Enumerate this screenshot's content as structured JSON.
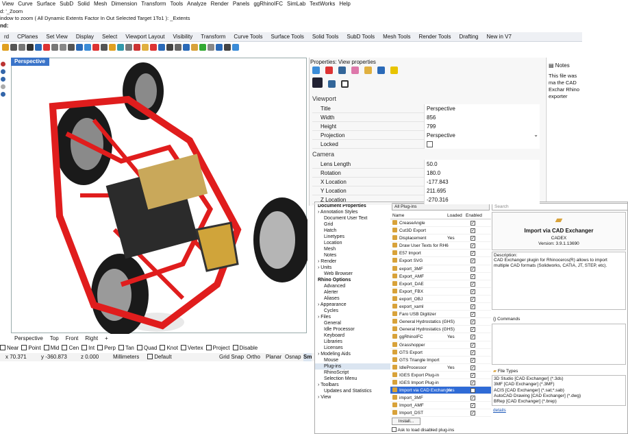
{
  "menubar": [
    "View",
    "Curve",
    "Surface",
    "SubD",
    "Solid",
    "Mesh",
    "Dimension",
    "Transform",
    "Tools",
    "Analyze",
    "Render",
    "Panels",
    "ggRhinoIFC",
    "SimLab",
    "TextWorks",
    "Help"
  ],
  "cmd": {
    "line1": "d: '_Zoom",
    "line2": "indow to zoom ( All  Dynamic  Extents  Factor  In  Out  Selected  Target  1To1 ): _Extents",
    "prompt": "nd:"
  },
  "tabs": [
    "rd",
    "CPlanes",
    "Set View",
    "Display",
    "Select",
    "Viewport Layout",
    "Visibility",
    "Transform",
    "Curve Tools",
    "Surface Tools",
    "Solid Tools",
    "SubD Tools",
    "Mesh Tools",
    "Render Tools",
    "Drafting",
    "New in V7"
  ],
  "viewport": {
    "title": "Perspective"
  },
  "vptabs": [
    "Perspective",
    "Top",
    "Front",
    "Right",
    "+"
  ],
  "osnap": [
    "Near",
    "Point",
    "Mid",
    "Cen",
    "Int",
    "Perp",
    "Tan",
    "Quad",
    "Knot",
    "Vertex",
    "Project",
    "Disable"
  ],
  "status": {
    "x": "x 70.371",
    "y": "y -360.873",
    "z": "z 0.000",
    "units": "Millimeters",
    "layer": "Default",
    "grid": "Grid Snap",
    "ortho": "Ortho",
    "planar": "Planar",
    "osnap": "Osnap",
    "sm": "Sm"
  },
  "props": {
    "title": "Properties: View properties",
    "sec1": "Viewport",
    "sec2": "Camera",
    "rows1": [
      {
        "k": "Title",
        "v": "Perspective"
      },
      {
        "k": "Width",
        "v": "856"
      },
      {
        "k": "Height",
        "v": "799"
      },
      {
        "k": "Projection",
        "v": "Perspective"
      },
      {
        "k": "Locked",
        "v": ""
      }
    ],
    "rows2": [
      {
        "k": "Lens Length",
        "v": "50.0"
      },
      {
        "k": "Rotation",
        "v": "180.0"
      },
      {
        "k": "X Location",
        "v": "-177.843"
      },
      {
        "k": "Y Location",
        "v": "211.695"
      },
      {
        "k": "Z Location",
        "v": "-270.316"
      }
    ]
  },
  "notes": {
    "title": "Notes",
    "text": "This file was ma the CAD Exchar Rhino exporter"
  },
  "tree": [
    {
      "t": "Document Properties",
      "b": true
    },
    {
      "t": "Annotation Styles",
      "c": true
    },
    {
      "t": "Document User Text"
    },
    {
      "t": "Grid"
    },
    {
      "t": "Hatch"
    },
    {
      "t": "Linetypes"
    },
    {
      "t": "Location"
    },
    {
      "t": "Mesh"
    },
    {
      "t": "Notes"
    },
    {
      "t": "Render",
      "c": true
    },
    {
      "t": "Units",
      "c": true
    },
    {
      "t": "Web Browser"
    },
    {
      "t": "Rhino Options",
      "b": true
    },
    {
      "t": "Advanced"
    },
    {
      "t": "Alerter"
    },
    {
      "t": "Aliases"
    },
    {
      "t": "Appearance",
      "c": true
    },
    {
      "t": "Cycles"
    },
    {
      "t": "Files",
      "c": true
    },
    {
      "t": "General"
    },
    {
      "t": "Idle Processor"
    },
    {
      "t": "Keyboard"
    },
    {
      "t": "Libraries"
    },
    {
      "t": "Licenses"
    },
    {
      "t": "Modeling Aids",
      "c": true
    },
    {
      "t": "Mouse"
    },
    {
      "t": "Plug-ins",
      "s": true
    },
    {
      "t": "RhinoScript"
    },
    {
      "t": "Selection Menu"
    },
    {
      "t": "Toolbars",
      "c": true
    },
    {
      "t": "Updates and Statistics"
    },
    {
      "t": "View",
      "c": true
    }
  ],
  "plugins": {
    "filter": "All Plug-ins",
    "search": "Search",
    "cols": [
      "Name",
      "Loaded",
      "Enabled"
    ],
    "items": [
      {
        "n": "CreaseAngle",
        "l": ""
      },
      {
        "n": "Cut3D Export",
        "l": ""
      },
      {
        "n": "Displacement",
        "l": "Yes"
      },
      {
        "n": "Draw User Texts for RH6",
        "l": ""
      },
      {
        "n": "E57 Import",
        "l": ""
      },
      {
        "n": "Export SVG",
        "l": ""
      },
      {
        "n": "export_3MF",
        "l": ""
      },
      {
        "n": "Export_AMF",
        "l": ""
      },
      {
        "n": "Export_DAE",
        "l": ""
      },
      {
        "n": "Export_FBX",
        "l": ""
      },
      {
        "n": "export_OBJ",
        "l": ""
      },
      {
        "n": "export_xaml",
        "l": ""
      },
      {
        "n": "Faro USB Digitizer",
        "l": ""
      },
      {
        "n": "General Hydrostatics (GHS)",
        "l": ""
      },
      {
        "n": "General Hydrostatics (GHS)",
        "l": ""
      },
      {
        "n": "ggRhinoIFC",
        "l": "Yes"
      },
      {
        "n": "Grasshopper",
        "l": ""
      },
      {
        "n": "GTS Export",
        "l": ""
      },
      {
        "n": "GTS Triangle Import",
        "l": ""
      },
      {
        "n": "IdleProcessor",
        "l": "Yes"
      },
      {
        "n": "IGES Export Plug-in",
        "l": ""
      },
      {
        "n": "IGES Import Plug-in",
        "l": ""
      },
      {
        "n": "Import via CAD Exchanger",
        "l": "Yes",
        "sel": true
      },
      {
        "n": "import_3MF",
        "l": ""
      },
      {
        "n": "Import_AMF",
        "l": ""
      },
      {
        "n": "Import_DST",
        "l": ""
      }
    ],
    "install": "Install...",
    "ask": "Ask to load disabled plug-ins"
  },
  "detail": {
    "name": "Import via CAD Exchanger",
    "vendor": "CADEX",
    "version": "Version: 3.9.1.13690",
    "desc_label": "Description:",
    "desc": "CAD Exchanger plugin for Rhinoceros(R) allows to import multiple CAD formats (Solidworks, CATIA, JT, STEP, etc).",
    "commands": "Commands",
    "filetypes": "File Types",
    "types": [
      "3D Studio [CAD Exchanger] (*.3ds)",
      "3MF [CAD Exchanger] (*.3MF)",
      "ACIS [CAD Exchanger] (*.sat;*.sab)",
      "AutoCAD Drawing [CAD Exchanger] (*.dwg)",
      "BRep [CAD Exchanger] (*.brep)"
    ],
    "details": "details"
  }
}
